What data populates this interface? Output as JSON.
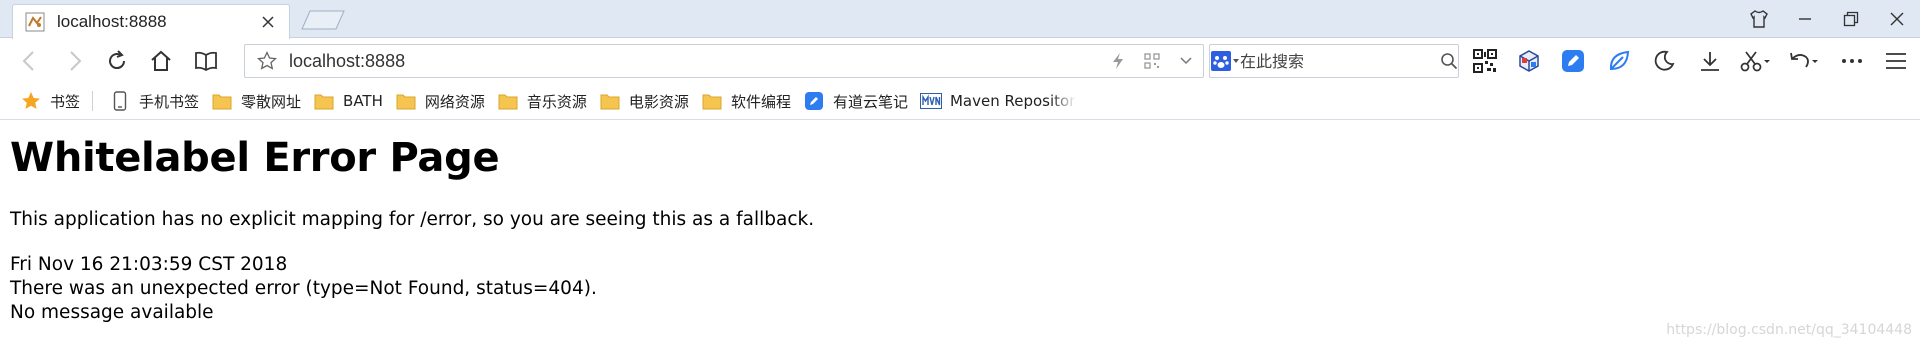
{
  "tab": {
    "title": "localhost:8888"
  },
  "address_bar": {
    "url": "localhost:8888"
  },
  "search_bar": {
    "placeholder": "在此搜索"
  },
  "bookmarks": [
    {
      "label": "书签",
      "icon": "star-icon"
    },
    {
      "label": "手机书签",
      "icon": "phone-icon"
    },
    {
      "label": "零散网址",
      "icon": "folder-icon"
    },
    {
      "label": "BATH",
      "icon": "folder-icon"
    },
    {
      "label": "网络资源",
      "icon": "folder-icon"
    },
    {
      "label": "音乐资源",
      "icon": "folder-icon"
    },
    {
      "label": "电影资源",
      "icon": "folder-icon"
    },
    {
      "label": "软件编程",
      "icon": "folder-icon"
    },
    {
      "label": "有道云笔记",
      "icon": "youdao-note-icon"
    },
    {
      "label": "Maven Repository",
      "icon": "mvn-icon"
    }
  ],
  "page": {
    "heading": "Whitelabel Error Page",
    "message": "This application has no explicit mapping for /error, so you are seeing this as a fallback.",
    "timestamp": "Fri Nov 16 21:03:59 CST 2018",
    "error_line": "There was an unexpected error (type=Not Found, status=404).",
    "detail": "No message available"
  },
  "watermark": "https://blog.csdn.net/qq_34104448",
  "colors": {
    "tabstrip_bg": "#dfe8f3",
    "folder": "#f6c550",
    "accent_blue": "#2d7cf0"
  }
}
